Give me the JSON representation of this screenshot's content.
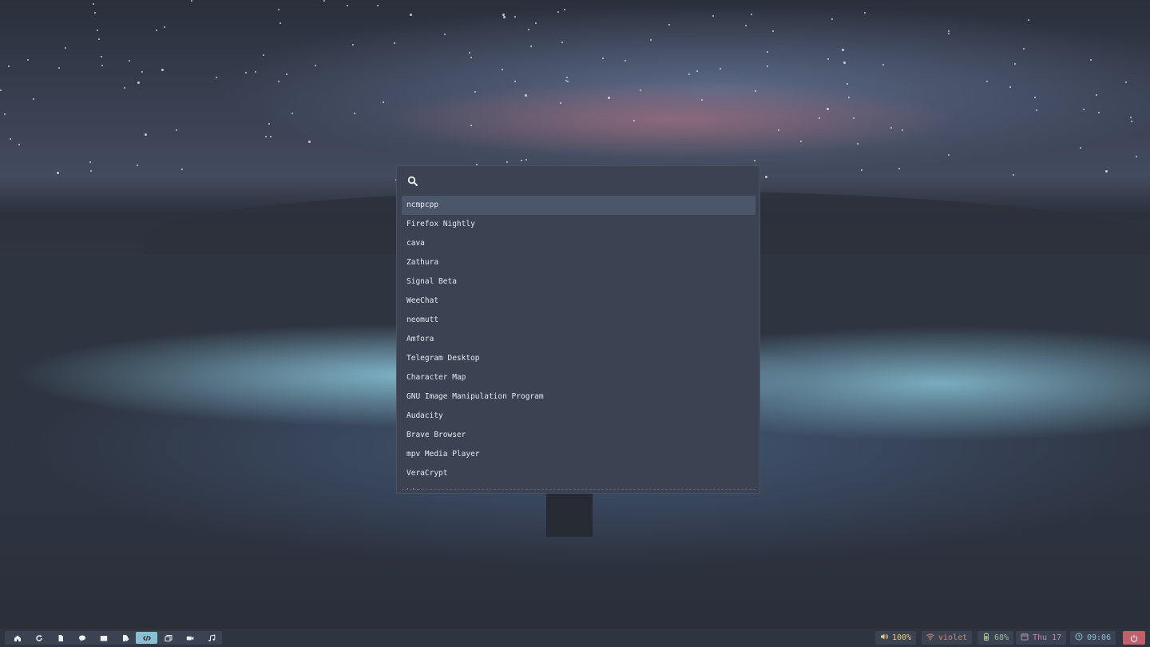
{
  "launcher": {
    "search_placeholder": "",
    "search_value": "",
    "items": [
      {
        "label": "ncmpcpp",
        "selected": true
      },
      {
        "label": "Firefox Nightly"
      },
      {
        "label": "cava"
      },
      {
        "label": "Zathura"
      },
      {
        "label": "Signal Beta"
      },
      {
        "label": "WeeChat"
      },
      {
        "label": "neomutt"
      },
      {
        "label": "Amfora"
      },
      {
        "label": "Telegram Desktop"
      },
      {
        "label": "Character Map"
      },
      {
        "label": "GNU Image Manipulation Program"
      },
      {
        "label": "Audacity"
      },
      {
        "label": "Brave Browser"
      },
      {
        "label": "mpv Media Player"
      },
      {
        "label": "VeraCrypt"
      },
      {
        "label": "kitty"
      }
    ]
  },
  "taskbar": {
    "workspaces": [
      {
        "icon": "home-icon",
        "active": false
      },
      {
        "icon": "refresh-icon",
        "active": false
      },
      {
        "icon": "file-icon",
        "active": false
      },
      {
        "icon": "chat-icon",
        "active": false
      },
      {
        "icon": "book-icon",
        "active": false
      },
      {
        "icon": "edit-icon",
        "active": false
      },
      {
        "icon": "code-icon",
        "active": true
      },
      {
        "icon": "windows-icon",
        "active": false
      },
      {
        "icon": "video-icon",
        "active": false
      },
      {
        "icon": "music-icon",
        "active": false
      }
    ],
    "volume": "100%",
    "wifi": "violet",
    "battery": "68%",
    "date": "Thu 17",
    "time": "09:06"
  },
  "colors": {
    "volume": "#ebcb8b",
    "wifi": "#d08770",
    "battery": "#a3be8c",
    "date": "#b48ead",
    "time": "#88c0d0",
    "power": "#bf616a",
    "active_workspace": "#88c0d0",
    "selected_item": "#4c566a"
  }
}
